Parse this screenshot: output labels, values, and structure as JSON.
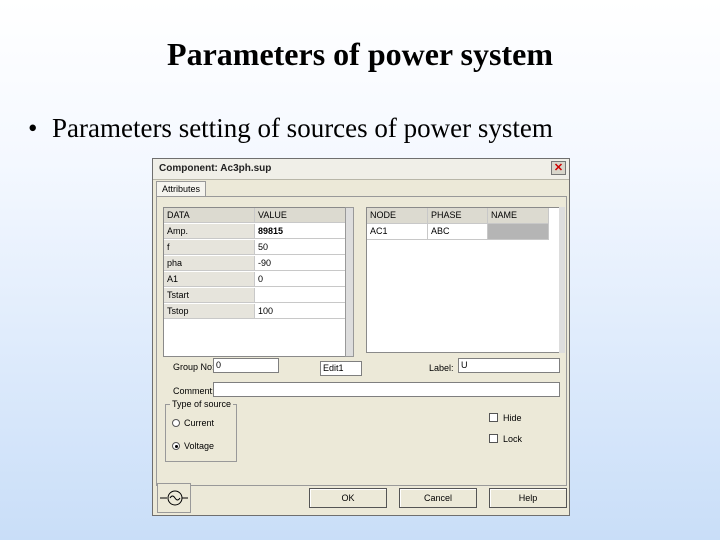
{
  "slide": {
    "title": "Parameters of power system",
    "bullet": "Parameters setting of sources of power system"
  },
  "dialog": {
    "title": "Component: Ac3ph.sup",
    "tab": "Attributes",
    "data_table": {
      "headers": [
        "DATA",
        "VALUE"
      ],
      "rows": [
        [
          "Amp.",
          "89815"
        ],
        [
          "f",
          "50"
        ],
        [
          "pha",
          "-90"
        ],
        [
          "A1",
          "0"
        ],
        [
          "Tstart",
          ""
        ],
        [
          "Tstop",
          "100"
        ]
      ]
    },
    "node_table": {
      "headers": [
        "NODE",
        "PHASE",
        "NAME"
      ],
      "row": [
        "AC1",
        "ABC",
        ""
      ]
    },
    "group_no_label": "Group No:",
    "group_no_value": "0",
    "edit_value": "Edit1",
    "label_label": "Label:",
    "label_value": "U",
    "comment_label": "Comment:",
    "comment_value": "",
    "source_type": {
      "legend": "Type of source",
      "options": [
        "Current",
        "Voltage"
      ],
      "selected": "Voltage"
    },
    "checkboxes": [
      "Hide",
      "Lock"
    ],
    "buttons": {
      "ok": "OK",
      "cancel": "Cancel",
      "help": "Help"
    },
    "close_glyph": "✕",
    "icons": [
      "close-icon",
      "voltage-source-icon"
    ]
  }
}
